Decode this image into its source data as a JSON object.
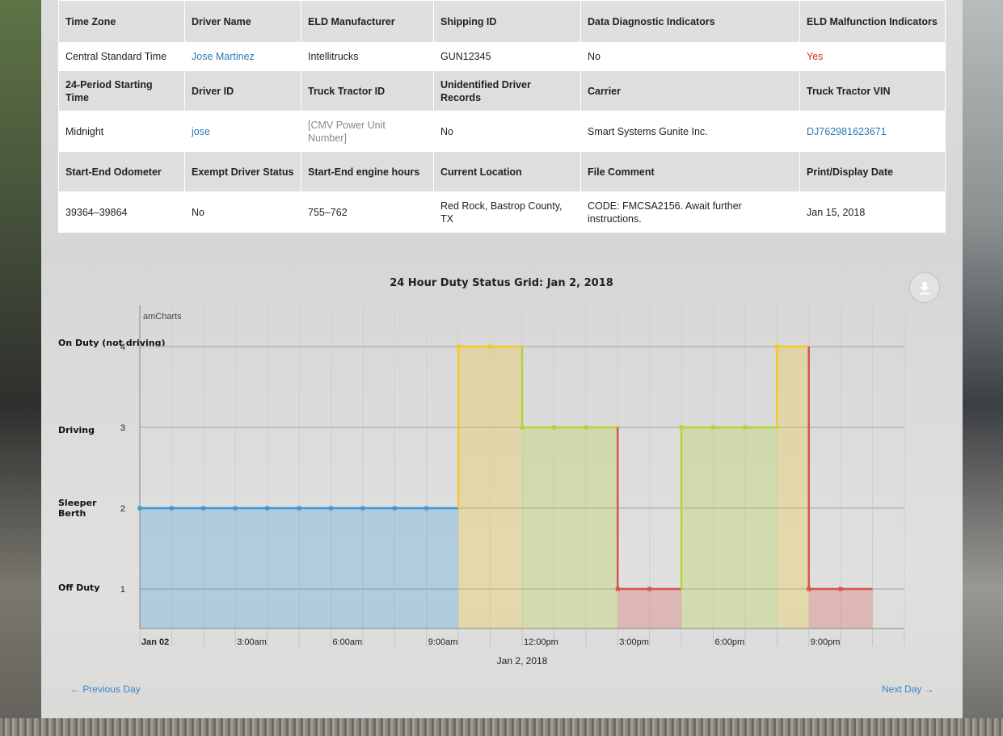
{
  "table": {
    "rows": [
      {
        "cells": [
          "Time Zone",
          "Driver Name",
          "ELD Manufacturer",
          "Shipping ID",
          "Data Diagnostic Indicators",
          "ELD Malfunction Indicators"
        ]
      },
      {
        "cells": [
          "Central Standard Time",
          "Jose Martinez",
          "Intellitrucks",
          "GUN12345",
          "No",
          "Yes"
        ]
      },
      {
        "cells": [
          "24-Period Starting Time",
          "Driver ID",
          "Truck Tractor ID",
          "Unidentified Driver Records",
          "Carrier",
          "Truck Tractor VIN"
        ]
      },
      {
        "cells": [
          "Midnight",
          "jose",
          "[CMV Power Unit Number]",
          "No",
          "Smart Systems Gunite Inc.",
          "DJ762981623671"
        ]
      },
      {
        "cells": [
          "Start-End Odometer",
          "Exempt Driver Status",
          "Start-End engine hours",
          "Current Location",
          "File Comment",
          "Print/Display Date"
        ]
      },
      {
        "cells": [
          "39364–39864",
          "No",
          "755–762",
          "Red Rock, Bastrop County, TX",
          "CODE: FMCSA2156. Await further instructions.",
          "Jan 15, 2018"
        ]
      }
    ]
  },
  "chart": {
    "watermark": "amCharts",
    "download_icon": "download-arrow-icon",
    "y_categories": [
      "On Duty (not driving)",
      "Driving",
      "Sleeper Berth",
      "Off Duty"
    ]
  },
  "chart_data": {
    "type": "line",
    "title": "24 Hour Duty Status Grid: Jan 2, 2018",
    "xlabel": "Jan 2, 2018",
    "ylabel": "",
    "x_unit": "hour of day",
    "xlim": [
      0,
      24
    ],
    "ylim": [
      0.5,
      4.5
    ],
    "step": true,
    "grid": true,
    "y_ticks": [
      1,
      2,
      3,
      4
    ],
    "y_tick_labels": [
      "1",
      "2",
      "3",
      "4"
    ],
    "x_tick_labels": [
      "Jan 02",
      "3:00am",
      "6:00am",
      "9:00am",
      "12:00pm",
      "3:00pm",
      "6:00pm",
      "9:00pm"
    ],
    "x_tick_hours": [
      0,
      3,
      6,
      9,
      12,
      15,
      18,
      21
    ],
    "status_levels": {
      "Off Duty": 1,
      "Sleeper Berth": 2,
      "Driving": 3,
      "On Duty (not driving)": 4
    },
    "segments": [
      {
        "start": 0,
        "end": 10,
        "status": 2,
        "color": "#3a9ad9"
      },
      {
        "start": 10,
        "end": 12,
        "status": 4,
        "color": "#f2c82b"
      },
      {
        "start": 12,
        "end": 15,
        "status": 3,
        "color": "#b5d334"
      },
      {
        "start": 15,
        "end": 17,
        "status": 1,
        "color": "#d9534f"
      },
      {
        "start": 17,
        "end": 20,
        "status": 3,
        "color": "#b5d334"
      },
      {
        "start": 20,
        "end": 21,
        "status": 4,
        "color": "#f2c82b"
      },
      {
        "start": 21,
        "end": 23,
        "status": 1,
        "color": "#d9534f"
      }
    ]
  },
  "nav": {
    "prev": "← Previous Day",
    "next": "Next Day →"
  }
}
